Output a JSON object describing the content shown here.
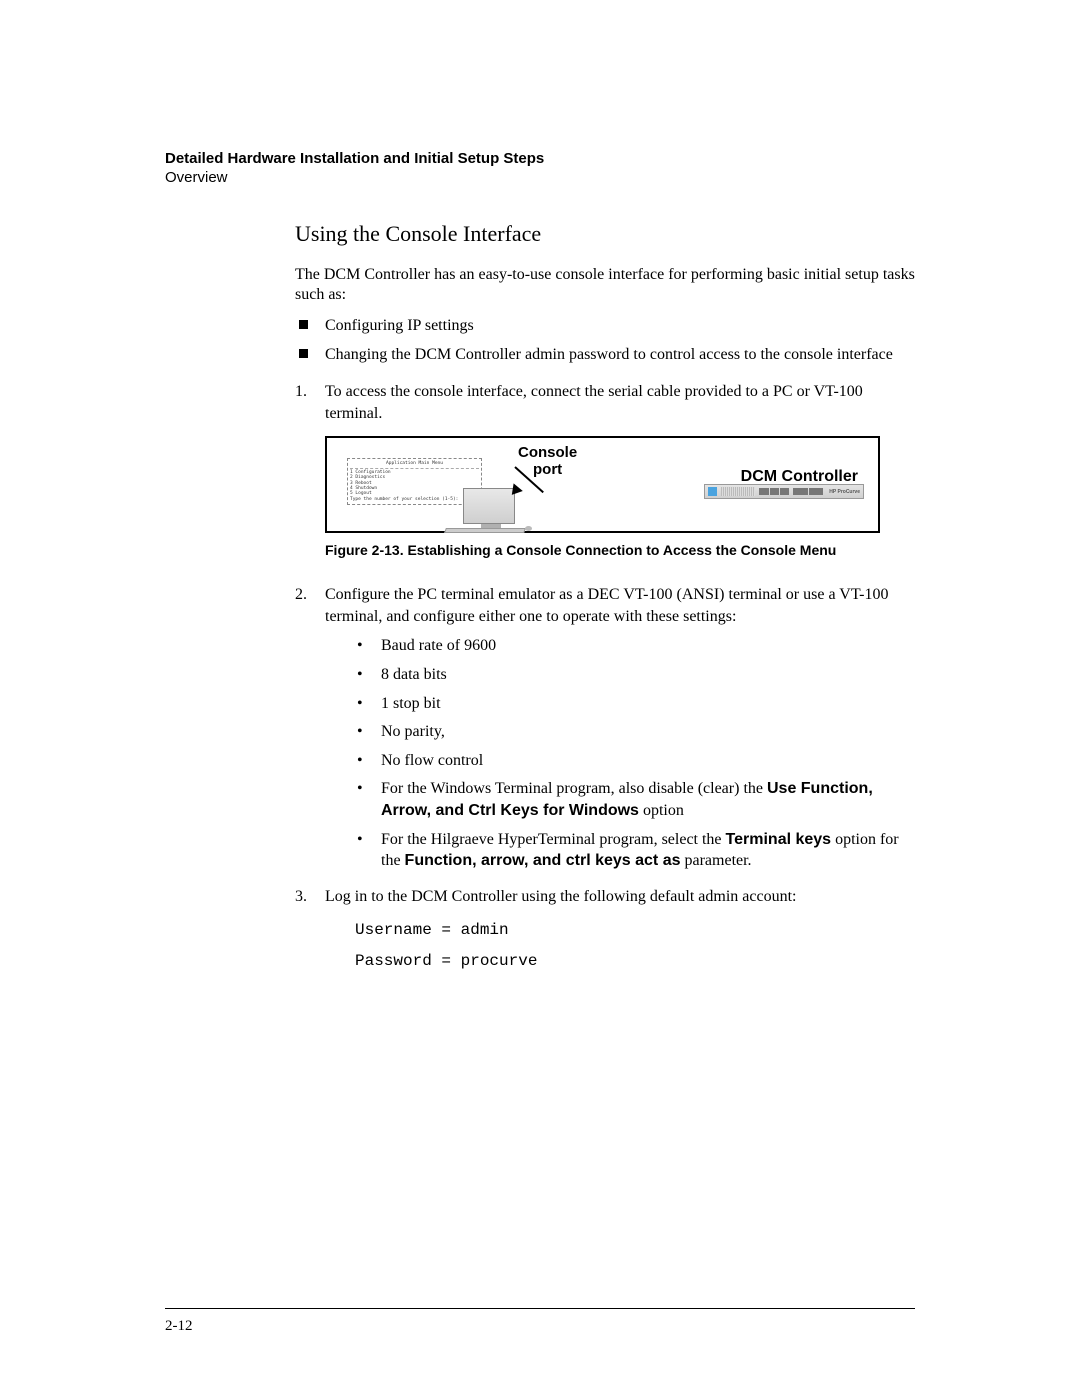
{
  "header": {
    "title": "Detailed Hardware Installation and Initial Setup Steps",
    "sub": "Overview"
  },
  "section": {
    "heading": "Using the Console Interface",
    "intro": "The DCM Controller has an easy-to-use console interface for performing basic initial setup tasks such as:"
  },
  "bullets": {
    "b1": "Configuring IP settings",
    "b2": "Changing the DCM Controller admin password to control access to the console interface"
  },
  "steps": {
    "s1": "To access the console interface, connect the serial cable provided to a PC or VT-100 terminal.",
    "s2": "Configure the PC terminal emulator as a DEC VT-100 (ANSI) terminal or use a VT-100 terminal, and configure either one to operate with these settings:",
    "s3": "Log in to the DCM Controller using the following default admin account:"
  },
  "figure": {
    "console_label": "Console\nport",
    "dcm_label": "DCM Controller",
    "menu_title": "Application Main Menu",
    "menu_items": "1 Configuration\n2 Diagnostics\n3 Reboot\n4 Shutdown\n5 Logout",
    "menu_prompt": "Type the number of your selection (1-5):",
    "brand": "HP ProCurve",
    "caption": "Figure 2-13. Establishing a Console Connection to Access the Console Menu"
  },
  "settings": {
    "d1": "Baud rate of 9600",
    "d2": "8 data bits",
    "d3": "1 stop bit",
    "d4": "No parity,",
    "d5": "No flow control",
    "d6a": "For the Windows Terminal program, also disable (clear) the ",
    "d6b": "Use Function, Arrow, and Ctrl Keys for Windows",
    "d6c": " option",
    "d7a": "For the Hilgraeve HyperTerminal program, select the ",
    "d7b": "Terminal keys",
    "d7c": " option for the ",
    "d7d": "Function, arrow, and ctrl keys act as",
    "d7e": " parameter."
  },
  "creds": {
    "line1": "Username = admin",
    "line2": "Password = procurve"
  },
  "footer": {
    "page": "2-12"
  }
}
